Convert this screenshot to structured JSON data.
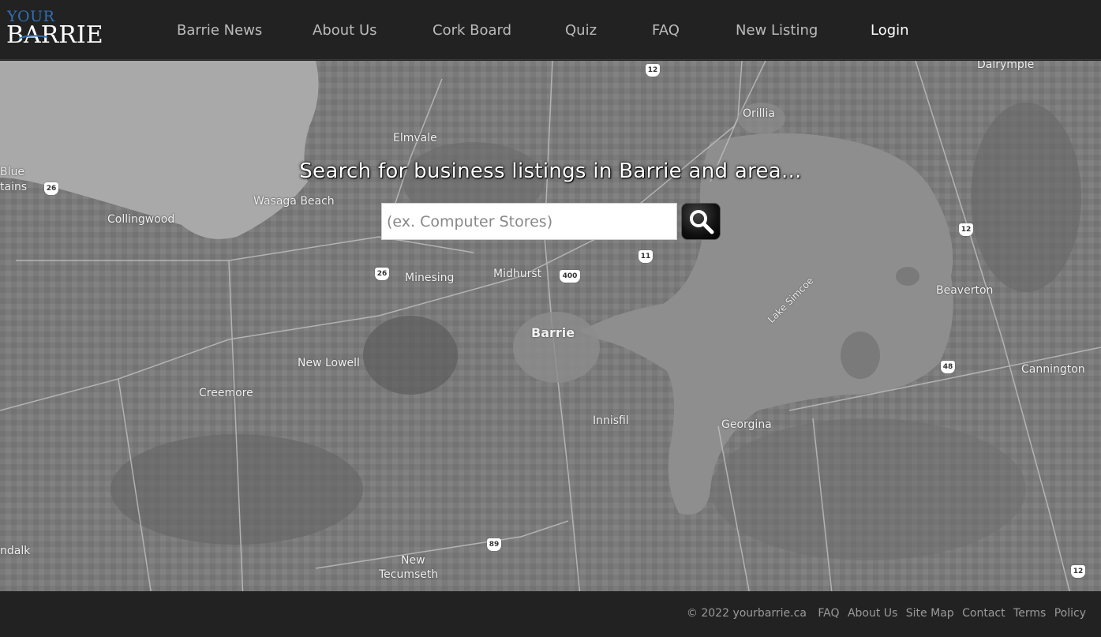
{
  "brand": {
    "logo_top": "YOUR",
    "logo_main": "BARRIE"
  },
  "nav": {
    "items": [
      {
        "label": "Barrie News"
      },
      {
        "label": "About Us"
      },
      {
        "label": "Cork Board"
      },
      {
        "label": "Quiz"
      },
      {
        "label": "FAQ"
      },
      {
        "label": "New Listing"
      },
      {
        "label": "Login"
      }
    ]
  },
  "hero": {
    "title": "Search for business listings in Barrie and area...",
    "search_placeholder": "(ex. Computer Stores)",
    "search_value": ""
  },
  "map": {
    "labels": {
      "dalrymple": "Dalrymple",
      "orillia": "Orillia",
      "elmvale": "Elmvale",
      "blue": "Blue",
      "tains": "tains",
      "wasaga_beach": "Wasaga Beach",
      "collingwood": "Collingwood",
      "minesing": "Minesing",
      "midhurst": "Midhurst",
      "barrie": "Barrie",
      "lake_simcoe": "Lake Simcoe",
      "beaverton": "Beaverton",
      "new_lowell": "New Lowell",
      "creemore": "Creemore",
      "innisfil": "Innisfil",
      "georgina": "Georgina",
      "cannington": "Cannington",
      "ndalk": "ndalk",
      "new": "New",
      "tecumseth": "Tecumseth"
    },
    "highways": {
      "h12a": "12",
      "h26a": "26",
      "h26b": "26",
      "h11": "11",
      "h400": "400",
      "h12b": "12",
      "h48": "48",
      "h89": "89",
      "h12c": "12"
    }
  },
  "footer": {
    "copyright": "© 2022 yourbarrie.ca",
    "links": [
      "FAQ",
      "About Us",
      "Site Map",
      "Contact",
      "Terms",
      "Policy"
    ]
  }
}
